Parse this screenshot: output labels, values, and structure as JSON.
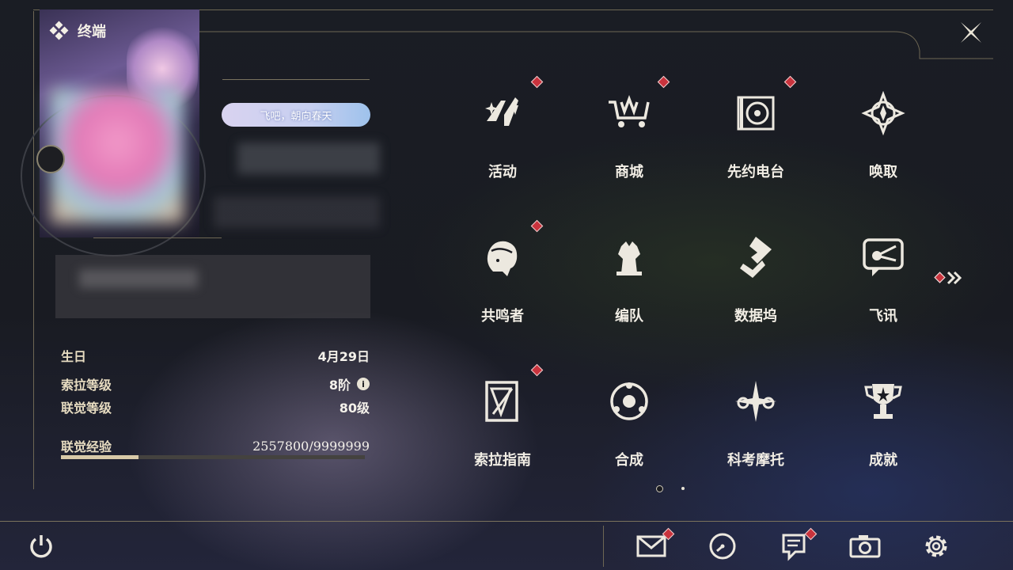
{
  "header": {
    "title": "终端"
  },
  "profile": {
    "banner_text": "飞吧，朝向春天",
    "birthday_label": "生日",
    "birthday_value": "4月29日",
    "sola_level_label": "索拉等级",
    "sola_level_value": "8阶",
    "union_level_label": "联觉等级",
    "union_level_value": "80级",
    "union_exp_label": "联觉经验",
    "union_exp_value": "2557800/9999999",
    "union_exp_progress": 0.2558
  },
  "menu": {
    "items": [
      {
        "label": "活动",
        "icon": "activity-icon",
        "badge": true
      },
      {
        "label": "商城",
        "icon": "shop-cart-icon",
        "badge": true
      },
      {
        "label": "先约电台",
        "icon": "radio-icon",
        "badge": true
      },
      {
        "label": "唤取",
        "icon": "summon-icon",
        "badge": false
      },
      {
        "label": "共鸣者",
        "icon": "resonator-icon",
        "badge": true
      },
      {
        "label": "编队",
        "icon": "team-chess-icon",
        "badge": false
      },
      {
        "label": "数据坞",
        "icon": "databank-icon",
        "badge": false
      },
      {
        "label": "飞讯",
        "icon": "message-icon",
        "badge": false
      },
      {
        "label": "索拉指南",
        "icon": "guide-icon",
        "badge": true
      },
      {
        "label": "合成",
        "icon": "synthesis-icon",
        "badge": false
      },
      {
        "label": "科考摩托",
        "icon": "motorbike-icon",
        "badge": false
      },
      {
        "label": "成就",
        "icon": "trophy-icon",
        "badge": false
      }
    ],
    "page_count": 2,
    "current_page": 1
  },
  "bottom_bar": {
    "buttons": [
      "power-icon",
      "mail-icon",
      "clock-icon",
      "notice-icon",
      "camera-icon",
      "settings-icon"
    ]
  },
  "colors": {
    "badge": "#c9333d",
    "accent": "#d8c9a8",
    "frame": "#6e6754"
  }
}
